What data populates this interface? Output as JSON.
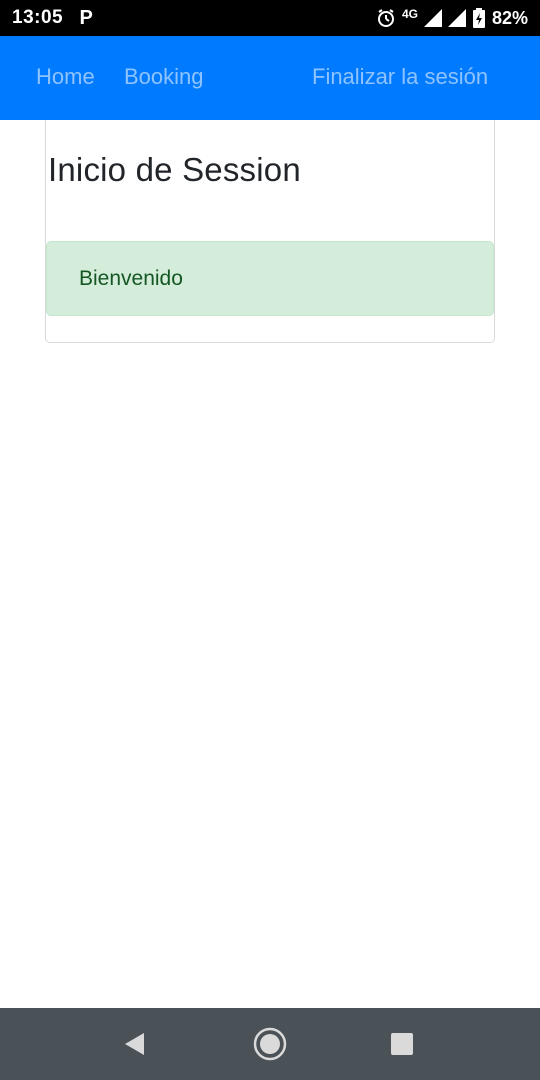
{
  "status_bar": {
    "time": "13:05",
    "p_label": "P",
    "network": "4G",
    "battery": "82%",
    "icons": [
      "alarm-icon",
      "signal-icon",
      "battery-icon"
    ]
  },
  "navbar": {
    "home": "Home",
    "booking": "Booking",
    "logout": "Finalizar la sesión",
    "background": "#007bff"
  },
  "card": {
    "title": "Inicio de Session",
    "alert": "Bienvenido",
    "alert_color": "#d4edda"
  },
  "system_nav": {
    "icons": [
      "back-icon",
      "home-icon",
      "recent-apps-icon"
    ]
  }
}
